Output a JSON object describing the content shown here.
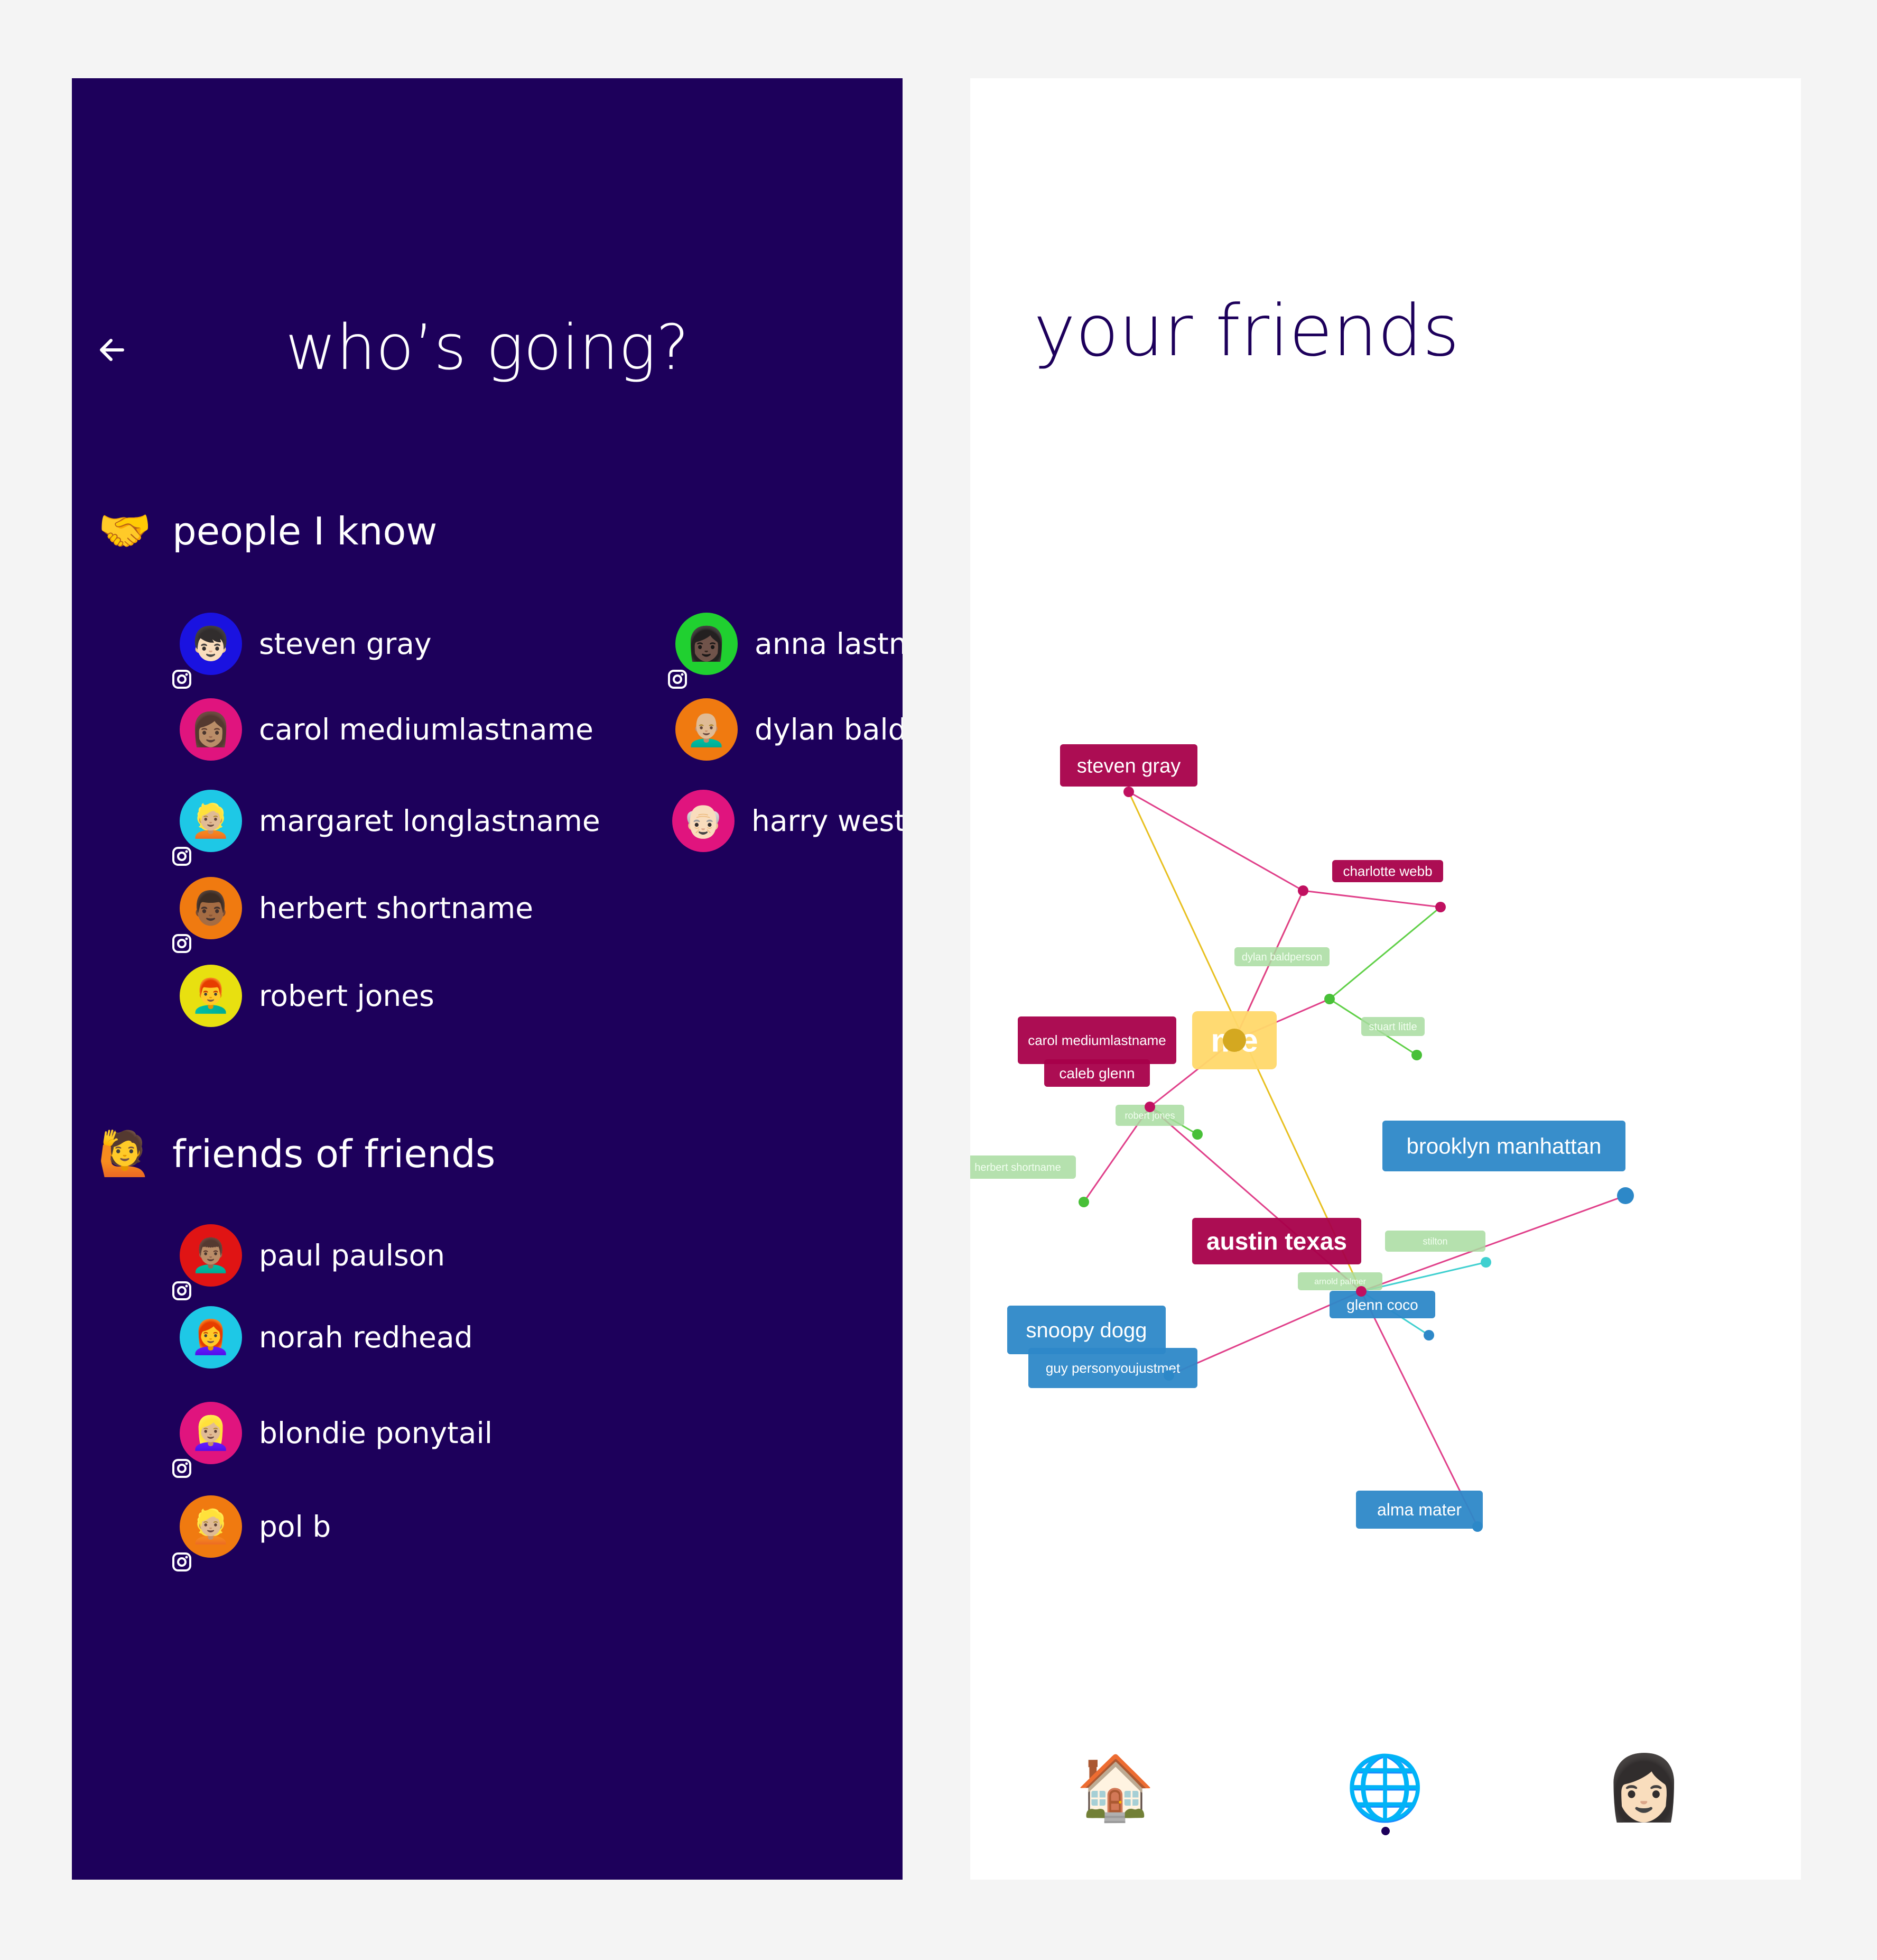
{
  "left_screen": {
    "title": "who’s going?",
    "back_icon": "arrow-left-icon",
    "section_known": {
      "emoji": "🤝",
      "label": "people I know"
    },
    "section_fof": {
      "emoji": "🙋",
      "label": "friends of friends"
    },
    "known": [
      {
        "name": "steven gray",
        "emoji": "👦🏻",
        "bg": "#1a12e0",
        "instagram": true
      },
      {
        "name": "carol mediumlastname",
        "emoji": "👩🏽",
        "bg": "#e0147e",
        "instagram": false
      },
      {
        "name": "margaret longlastname",
        "emoji": "👱🏼",
        "bg": "#1ec8e6",
        "instagram": true
      },
      {
        "name": "herbert shortname",
        "emoji": "👨🏾",
        "bg": "#f07a10",
        "instagram": true
      },
      {
        "name": "robert jones",
        "emoji": "👨‍🦰",
        "bg": "#e8e010",
        "instagram": false
      },
      {
        "name": "anna lastna",
        "emoji": "👩🏿",
        "bg": "#20d030",
        "instagram": true
      },
      {
        "name": "dylan baldp",
        "emoji": "👨🏼‍🦲",
        "bg": "#f07a10",
        "instagram": false
      },
      {
        "name": "harry west",
        "emoji": "👴🏻",
        "bg": "#e0147e",
        "instagram": false
      }
    ],
    "friends_of_friends": [
      {
        "name": "paul paulson",
        "emoji": "👨🏽‍🦱",
        "bg": "#e01414",
        "instagram": true
      },
      {
        "name": "norah redhead",
        "emoji": "👩‍🦰",
        "bg": "#1ec8e6",
        "instagram": false
      },
      {
        "name": "blondie ponytail",
        "emoji": "👱🏼‍♀️",
        "bg": "#e0147e",
        "instagram": true
      },
      {
        "name": "pol b",
        "emoji": "👱🏼",
        "bg": "#f07a10",
        "instagram": true
      }
    ]
  },
  "right_screen": {
    "title": "your friends",
    "graph": {
      "me": "me",
      "people": [
        "steven gray",
        "charlotte webb",
        "dylan baldperson",
        "stuart little",
        "carol mediumlastname",
        "caleb glenn",
        "robert jones",
        "herbert shortname"
      ],
      "places": [
        "brooklyn manhattan",
        "austin texas",
        "snoopy dogg",
        "guy personyoujustmet",
        "alma mater",
        "glenn coco",
        "arnold palmer",
        "stilton"
      ],
      "colors": {
        "friend": "#a8004a",
        "me": "#ffd86a",
        "place": "#2d88c8",
        "fof": "#a8dca0"
      }
    },
    "nav": [
      {
        "emoji": "🏠",
        "icon": "home-icon"
      },
      {
        "emoji": "🌐",
        "icon": "globe-icon"
      },
      {
        "emoji": "👩🏻",
        "icon": "profile-icon"
      }
    ]
  }
}
